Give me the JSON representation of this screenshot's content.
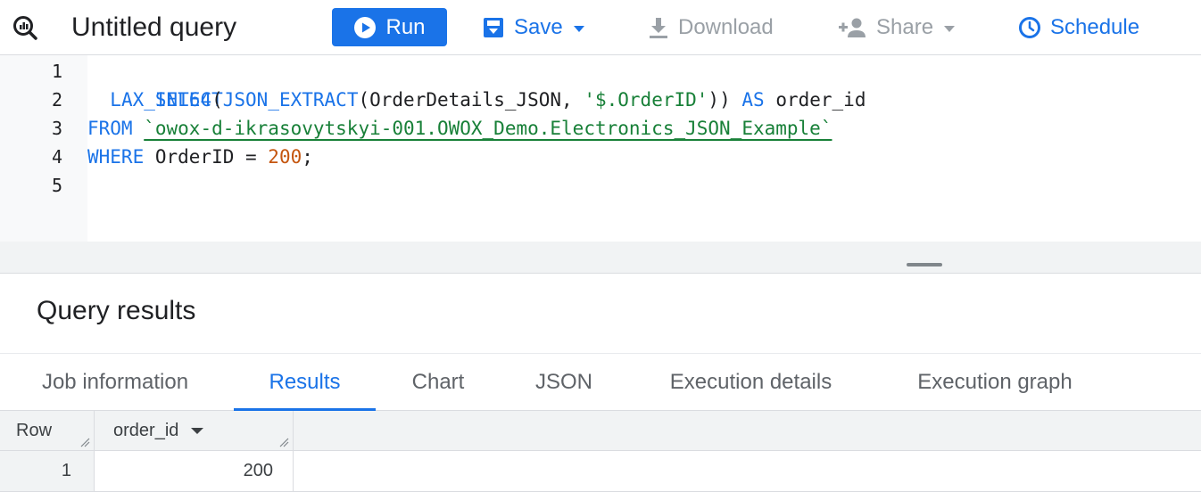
{
  "toolbar": {
    "title": "Untitled query",
    "run_label": "Run",
    "save_label": "Save",
    "download_label": "Download",
    "share_label": "Share",
    "schedule_label": "Schedule"
  },
  "editor": {
    "line_numbers": [
      "1",
      "2",
      "3",
      "4",
      "5"
    ],
    "lines": {
      "l1": {
        "kw": "SELECT"
      },
      "l2": {
        "indent": "  ",
        "fn1": "LAX_INT64",
        "p1": "(",
        "fn2": "JSON_EXTRACT",
        "p2": "(",
        "arg": "OrderDetails_JSON, ",
        "str": "'$.OrderID'",
        "p3": "))",
        "sp": " ",
        "as": "AS",
        "alias": " order_id"
      },
      "l3": {
        "kw": "FROM",
        "sp": " ",
        "table": "`owox-d-ikrasovytskyi-001.OWOX_Demo.Electronics_JSON_Example`"
      },
      "l4": {
        "kw": "WHERE",
        "cond": " OrderID = ",
        "num": "200",
        "end": ";"
      }
    }
  },
  "results": {
    "title": "Query results",
    "tabs": [
      "Job information",
      "Results",
      "Chart",
      "JSON",
      "Execution details",
      "Execution graph"
    ],
    "active_tab": "Results",
    "columns": [
      "Row",
      "order_id"
    ],
    "rows": [
      {
        "row": "1",
        "order_id": "200"
      }
    ]
  },
  "colors": {
    "accent": "#1a73e8",
    "string": "#188038",
    "number": "#c5560f",
    "disabled": "#9aa0a6"
  }
}
